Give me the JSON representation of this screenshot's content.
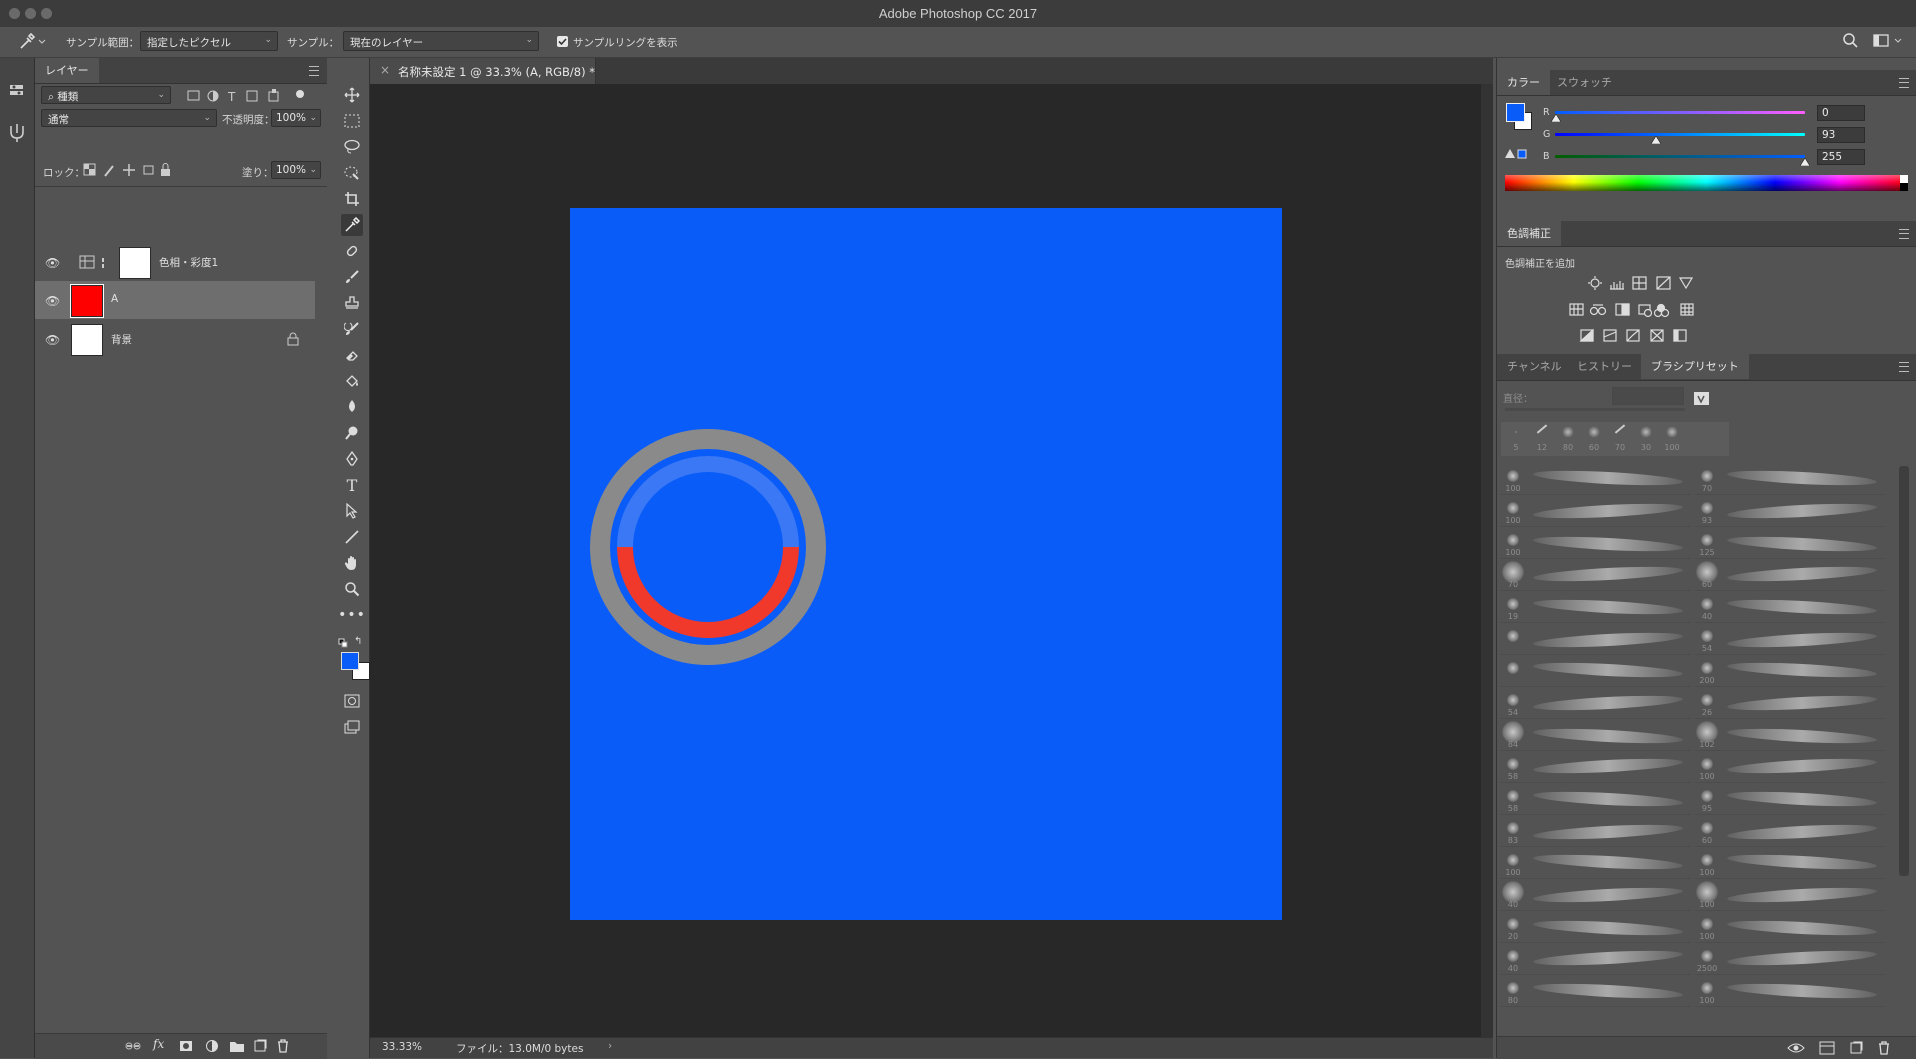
{
  "app": {
    "title": "Adobe Photoshop CC 2017"
  },
  "options_bar": {
    "sample_size_label": "サンプル範囲：",
    "sample_size_value": "指定したピクセル",
    "sample_label": "サンプル：",
    "sample_value": "現在のレイヤー",
    "show_ring_label": "サンプルリングを表示",
    "show_ring_checked": true
  },
  "layers_panel": {
    "tab": "レイヤー",
    "filter_kind": "種類",
    "blend_mode": "通常",
    "opacity_label": "不透明度：",
    "opacity_value": "100%",
    "lock_label": "ロック：",
    "fill_label": "塗り：",
    "fill_value": "100%",
    "layers": [
      {
        "name": "色相・彩度1",
        "type": "adjustment",
        "visible": true,
        "selected": false
      },
      {
        "name": "A",
        "type": "pixel",
        "thumb_color": "#ff0000",
        "visible": true,
        "selected": true
      },
      {
        "name": "背景",
        "type": "background",
        "thumb_color": "#ffffff",
        "visible": true,
        "selected": false,
        "locked": true
      }
    ],
    "footer_icons": [
      "link-icon",
      "fx-icon",
      "mask-icon",
      "adjustment-icon",
      "folder-icon",
      "new-layer-icon",
      "trash-icon"
    ]
  },
  "document": {
    "tab_title": "名称未設定 1 @ 33.3% (A, RGB/8) *",
    "canvas_color": "#0a5cf9",
    "zoom": "33.33%",
    "file_info": "ファイル：13.0M/0 bytes",
    "sampler_ring": {
      "top_color": "#3a78f5",
      "bottom_color": "#f0392b",
      "outer_color": "#888888"
    }
  },
  "color_panel": {
    "tabs": [
      "カラー",
      "スウォッチ"
    ],
    "foreground": "#0a5cf9",
    "background": "#ffffff",
    "r_label": "R",
    "r_value": "0",
    "g_label": "G",
    "g_value": "93",
    "b_label": "B",
    "b_value": "255"
  },
  "adjustments_panel": {
    "tab": "色調補正",
    "add_label": "色調補正を追加"
  },
  "brush_panel": {
    "tabs": [
      "チャンネル",
      "ヒストリー",
      "ブラシプリセット"
    ],
    "size_label": "直径：",
    "recent_sizes": [
      "5",
      "12",
      "80",
      "60",
      "70",
      "30",
      "100"
    ],
    "left_sizes": [
      "100",
      "100",
      "100",
      "70",
      "19",
      "",
      "",
      "54",
      "84",
      "58",
      "58",
      "83",
      "100",
      "40",
      "20",
      "40",
      "80"
    ],
    "right_sizes": [
      "70",
      "93",
      "125",
      "60",
      "40",
      "54",
      "200",
      "26",
      "102",
      "100",
      "95",
      "60",
      "100",
      "100",
      "100",
      "2500",
      "100"
    ]
  }
}
